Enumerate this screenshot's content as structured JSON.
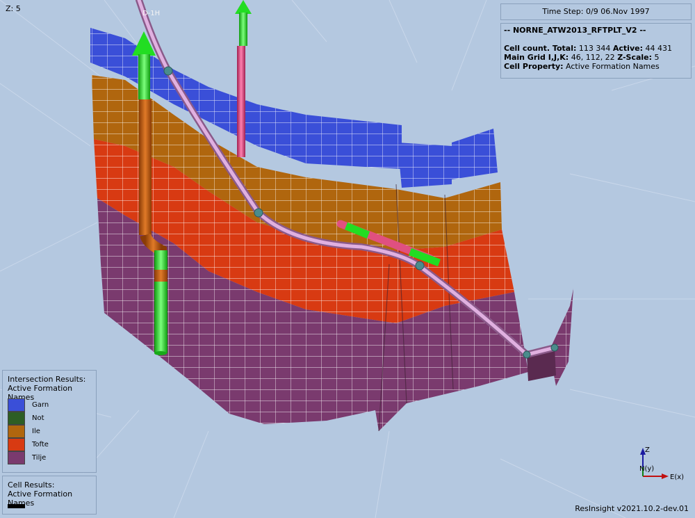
{
  "viewer": {
    "z_scale_label": "Z: 5",
    "time_step": "Time Step: 0/9 06.Nov 1997",
    "version": "ResInsight v2021.10.2-dev.01",
    "well_label": "D-1H"
  },
  "info": {
    "case_name": "-- NORNE_ATW2013_RFTPLT_V2 --",
    "cell_count_label": "Cell count. Total:",
    "cell_count_total": "113 344",
    "active_label": "Active:",
    "active_count": "44 431",
    "grid_label": "Main Grid I,J,K:",
    "grid_dims": "46, 112, 22",
    "zscale_label": "Z-Scale:",
    "zscale_value": "5",
    "property_label": "Cell Property:",
    "property_value": "Active Formation Names"
  },
  "legend_intersection": {
    "title_line1": "Intersection Results:",
    "title_line2": "Active Formation Names",
    "items": [
      {
        "label": "Garn",
        "color": "#3a4fd8"
      },
      {
        "label": "Not",
        "color": "#2d5e24"
      },
      {
        "label": "Ile",
        "color": "#b0660e"
      },
      {
        "label": "Tofte",
        "color": "#d83a12"
      },
      {
        "label": "Tilje",
        "color": "#7a3a6e"
      }
    ]
  },
  "legend_cells": {
    "title_line1": "Cell Results:",
    "title_line2": "Active Formation Names"
  },
  "axes": {
    "z": "Z",
    "y": "N(y)",
    "x": "E(x)"
  },
  "colors": {
    "background": "#b4c8e0",
    "grid_lines": "#ffffff",
    "well_main": "#c890c8",
    "well_green": "#22dd22",
    "well_orange": "#c05a10",
    "well_pink": "#e05080"
  }
}
